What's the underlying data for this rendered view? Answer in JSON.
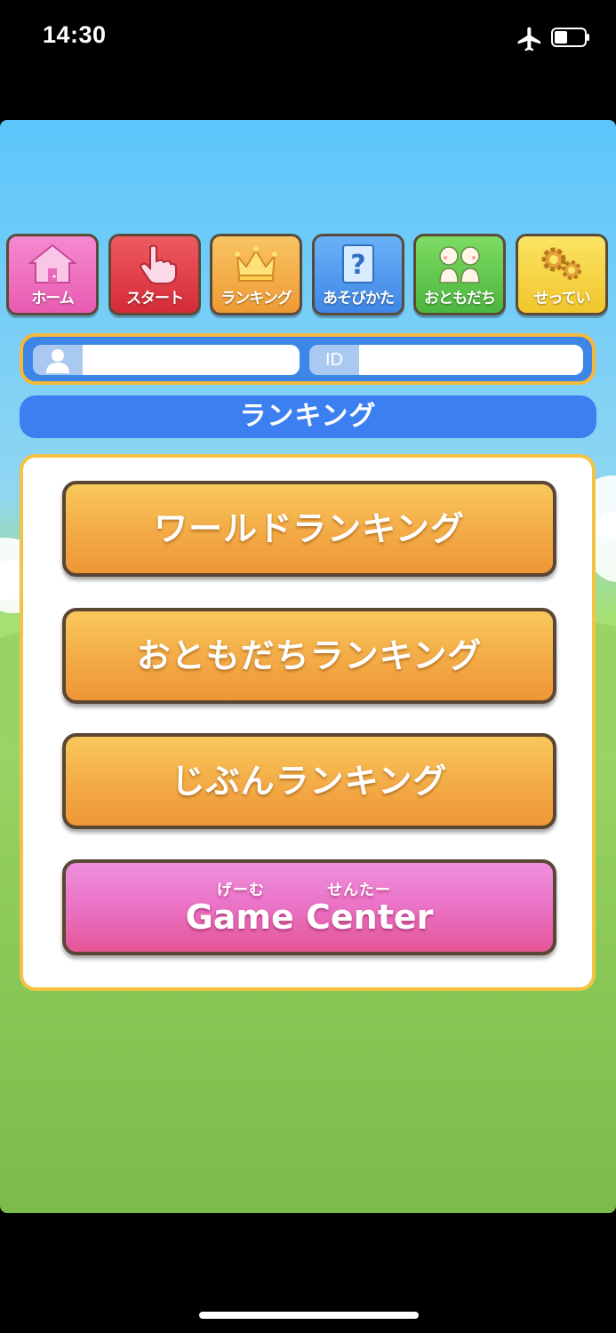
{
  "status": {
    "time": "14:30",
    "icons": [
      "airplane-icon",
      "battery-icon"
    ]
  },
  "nav": {
    "items": [
      {
        "label": "ホーム",
        "icon": "home-icon",
        "color": "#ef6fc0"
      },
      {
        "label": "スタート",
        "icon": "hand-pointer-icon",
        "color": "#e23c46"
      },
      {
        "label": "ランキング",
        "icon": "crown-icon",
        "color": "#f3b24a"
      },
      {
        "label": "あそびかた",
        "icon": "question-icon",
        "color": "#4e9cf2"
      },
      {
        "label": "おともだち",
        "icon": "friends-icon",
        "color": "#5ec750"
      },
      {
        "label": "せってい",
        "icon": "gear-icon",
        "color": "#f6d53d"
      }
    ]
  },
  "player_info": {
    "name_value": "",
    "id_tag": "ID",
    "id_value": ""
  },
  "section": {
    "title": "ランキング"
  },
  "buttons": {
    "world": "ワールドランキング",
    "friends": "おともだちランキング",
    "self": "じぶんランキング",
    "game_center": {
      "ruby_1": "げーむ",
      "ruby_2": "せんたー",
      "label": "Game Center"
    }
  },
  "colors": {
    "sky": "#5cc6fb",
    "grass": "#8cc856",
    "panel_border": "#f5c343",
    "title_bar": "#3b7ff0",
    "orange_button": "#f4ad48",
    "pink_button": "#ea72c5"
  }
}
